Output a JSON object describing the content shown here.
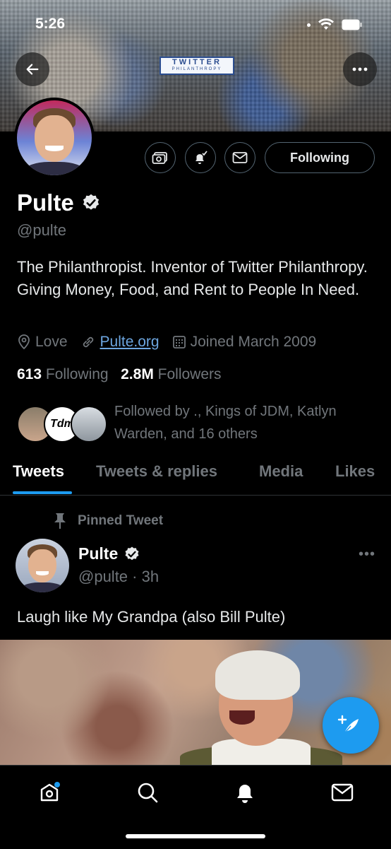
{
  "status_bar": {
    "time": "5:26"
  },
  "header": {
    "banner_logo_line1": "TWITTER",
    "banner_logo_line2": "PHILANTHROPY"
  },
  "profile": {
    "name": "Pulte",
    "handle": "@pulte",
    "bio": "The Philanthropist. Inventor of Twitter Philanthropy. Giving Money, Food, and Rent to People In Need.",
    "location": "Love",
    "website": "Pulte.org",
    "joined": "Joined March 2009",
    "following_count": "613",
    "following_label": "Following",
    "followers_count": "2.8M",
    "followers_label": "Followers",
    "followed_by": "Followed by ., Kings of JDM, Katlyn Warden, and 16 others",
    "follow_button_label": "Following"
  },
  "tabs": [
    {
      "label": "Tweets",
      "active": true
    },
    {
      "label": "Tweets & replies",
      "active": false
    },
    {
      "label": "Media",
      "active": false
    },
    {
      "label": "Likes",
      "active": false
    }
  ],
  "pinned_tweet": {
    "pinned_label": "Pinned Tweet",
    "author_name": "Pulte",
    "author_handle": "@pulte",
    "time": "3h",
    "text": "Laugh like My Grandpa (also Bill Pulte)",
    "more": "•••"
  },
  "mini_avatar_text": "Tdm",
  "colors": {
    "accent": "#1d9bf0",
    "background": "#000000",
    "muted_text": "#71767b",
    "link": "#6da6e0"
  },
  "icons": {
    "back": "arrow-left-icon",
    "more": "more-horizontal-icon",
    "tip": "money-icon",
    "notify": "bell-check-icon",
    "message": "mail-icon",
    "verified": "verified-badge-icon",
    "compose": "feather-plus-icon"
  }
}
